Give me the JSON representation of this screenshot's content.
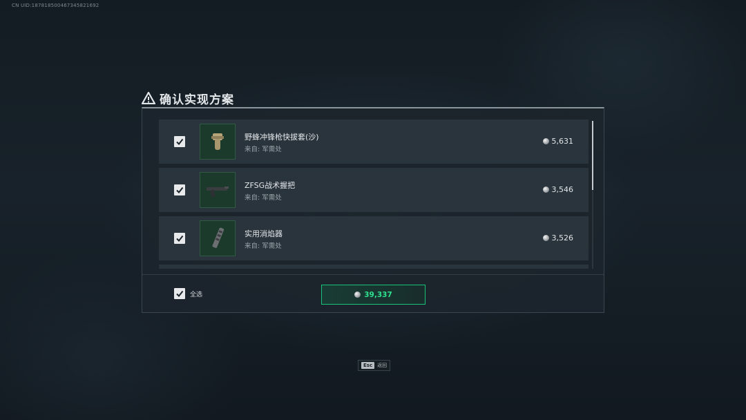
{
  "uid_text": "CN UID:187818500467345821692",
  "dialog": {
    "title": "确认实现方案",
    "items": [
      {
        "name": "野蜂冲锋枪快拔套(沙)",
        "source": "来自:  军需处",
        "price": "5,631",
        "checked": true,
        "icon": "grip-attachment-icon"
      },
      {
        "name": "ZFSG战术握把",
        "source": "来自:  军需处",
        "price": "3,546",
        "checked": true,
        "icon": "tactical-grip-icon"
      },
      {
        "name": "实用消焰器",
        "source": "来自:  军需处",
        "price": "3,526",
        "checked": true,
        "icon": "flash-hider-icon"
      }
    ],
    "footer": {
      "select_all_label": "全选",
      "select_all_checked": true,
      "total": "39,337"
    }
  },
  "esc_hint": {
    "key": "Esc",
    "label": "返回"
  },
  "colors": {
    "accent_green": "#2fe28f",
    "panel": "#1c252d",
    "row": "#2a343c",
    "thumb_bg": "#1b3a2c"
  }
}
